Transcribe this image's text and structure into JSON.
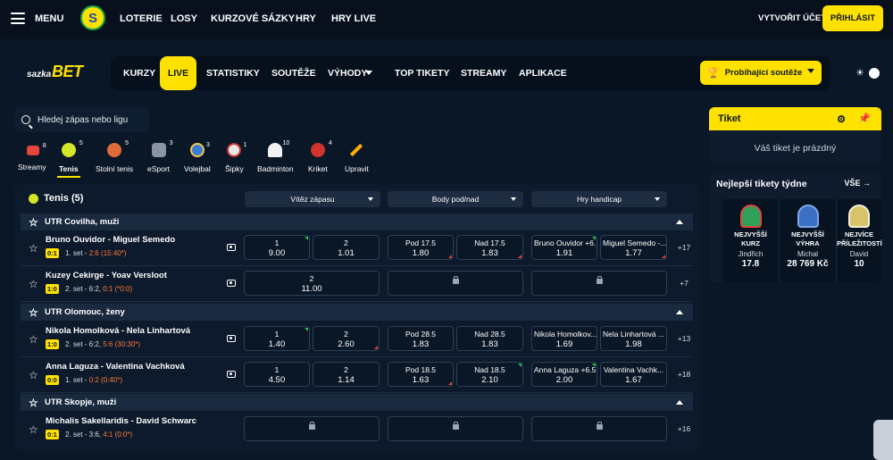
{
  "topbar": {
    "menu": "MENU",
    "nav": [
      "LOTERIE",
      "LOSY",
      "KURZOVÉ SÁZKY",
      "HRY",
      "HRY LIVE"
    ],
    "create_account": "VYTVOŘIT ÚČET",
    "login": "PŘIHLÁSIT"
  },
  "brand": {
    "sazka": "sazka",
    "bet": "BET"
  },
  "mainnav": {
    "items": [
      "KURZY",
      "LIVE",
      "STATISTIKY",
      "SOUTĚŽE",
      "VÝHODY",
      "TOP TIKETY",
      "STREAMY",
      "APLIKACE"
    ],
    "competitions": "Probíhající soutěže"
  },
  "search": {
    "placeholder": "Hledej zápas nebo ligu"
  },
  "sports": [
    {
      "label": "Streamy",
      "count": "8",
      "color": "#e2463d"
    },
    {
      "label": "Tenis",
      "count": "5",
      "color": "#d5e52a"
    },
    {
      "label": "Stolní tenis",
      "count": "5",
      "color": "#e06a3a"
    },
    {
      "label": "eSport",
      "count": "3",
      "color": "#8a94a6"
    },
    {
      "label": "Volejbal",
      "count": "3",
      "color": "#3a7bd5"
    },
    {
      "label": "Šipky",
      "count": "1",
      "color": "#e8e8e8"
    },
    {
      "label": "Badminton",
      "count": "10",
      "color": "#f2f2f2"
    },
    {
      "label": "Kriket",
      "count": "4",
      "color": "#d0342c"
    },
    {
      "label": "Upravit",
      "count": "",
      "color": "#ffb000"
    }
  ],
  "panel": {
    "title": "Tenis (5)",
    "dropdowns": [
      "Vítěz zápasu",
      "Body pod/nad",
      "Hry handicap"
    ]
  },
  "leagues": [
    {
      "name": "UTR Covilha, muži"
    },
    {
      "name": "UTR Olomouc, ženy"
    },
    {
      "name": "UTR Skopje, muži"
    }
  ],
  "matches": [
    {
      "teams": "Bruno Ouvidor - Miguel Semedo",
      "score": "0:1",
      "info_a": "1. set - ",
      "info_b": "2:6 (15:40*)",
      "odds": [
        {
          "l": "1",
          "v": "9.00"
        },
        {
          "l": "2",
          "v": "1.01"
        },
        {
          "l": "Pod 17.5",
          "v": "1.80"
        },
        {
          "l": "Nad 17.5",
          "v": "1.83"
        },
        {
          "l": "Bruno Ouvidor +6...",
          "v": "1.91"
        },
        {
          "l": "Miguel Semedo -...",
          "v": "1.77"
        }
      ],
      "more": "+17"
    },
    {
      "teams": "Kuzey Cekirge - Yoav Versloot",
      "score": "1:0",
      "info_a": "2. set - 6:2, ",
      "info_b": "0:1 (*0:0)",
      "odds": [
        {
          "l": "2",
          "v": "11.00"
        }
      ],
      "more": "+7"
    },
    {
      "teams": "Nikola Homolková - Nela Linhartová",
      "score": "1:0",
      "info_a": "2. set - 6:2, ",
      "info_b": "5:6 (30:30*)",
      "odds": [
        {
          "l": "1",
          "v": "1.40"
        },
        {
          "l": "2",
          "v": "2.60"
        },
        {
          "l": "Pod 28.5",
          "v": "1.83"
        },
        {
          "l": "Nad 28.5",
          "v": "1.83"
        },
        {
          "l": "Nikola Homolkov...",
          "v": "1.69"
        },
        {
          "l": "Nela Linhartová ...",
          "v": "1.98"
        }
      ],
      "more": "+13"
    },
    {
      "teams": "Anna Laguza - Valentina Vachková",
      "score": "0:0",
      "info_a": "1. set - ",
      "info_b": "0:2 (0:40*)",
      "odds": [
        {
          "l": "1",
          "v": "4.50"
        },
        {
          "l": "2",
          "v": "1.14"
        },
        {
          "l": "Pod 18.5",
          "v": "1.63"
        },
        {
          "l": "Nad 18.5",
          "v": "2.10"
        },
        {
          "l": "Anna Laguza +6.5",
          "v": "2.00"
        },
        {
          "l": "Valentina Vachk...",
          "v": "1.67"
        }
      ],
      "more": "+18"
    },
    {
      "teams": "Michalis Sakellaridis - David Schwarc",
      "score": "0:1",
      "info_a": "2. set - 3:6, ",
      "info_b": "4:1 (0:0*)",
      "odds": [],
      "more": "+16"
    }
  ],
  "ticket": {
    "title": "Tiket",
    "empty": "Váš tiket je prázdný"
  },
  "best": {
    "title": "Nejlepší tikety týdne",
    "all": "VŠE",
    "tiles": [
      {
        "title1": "NEJVYŠŠÍ",
        "title2": "KURZ",
        "name": "Jindřich",
        "value": "17.8",
        "color": "#2fa05a"
      },
      {
        "title1": "NEJVYŠŠÍ",
        "title2": "VÝHRA",
        "name": "Michal",
        "value": "28 769 Kč",
        "color": "#3b6fc4"
      },
      {
        "title1": "NEJVÍCE",
        "title2": "PŘÍLEŽITOSTÍ",
        "name": "David",
        "value": "10",
        "color": "#d9c36a"
      }
    ]
  }
}
